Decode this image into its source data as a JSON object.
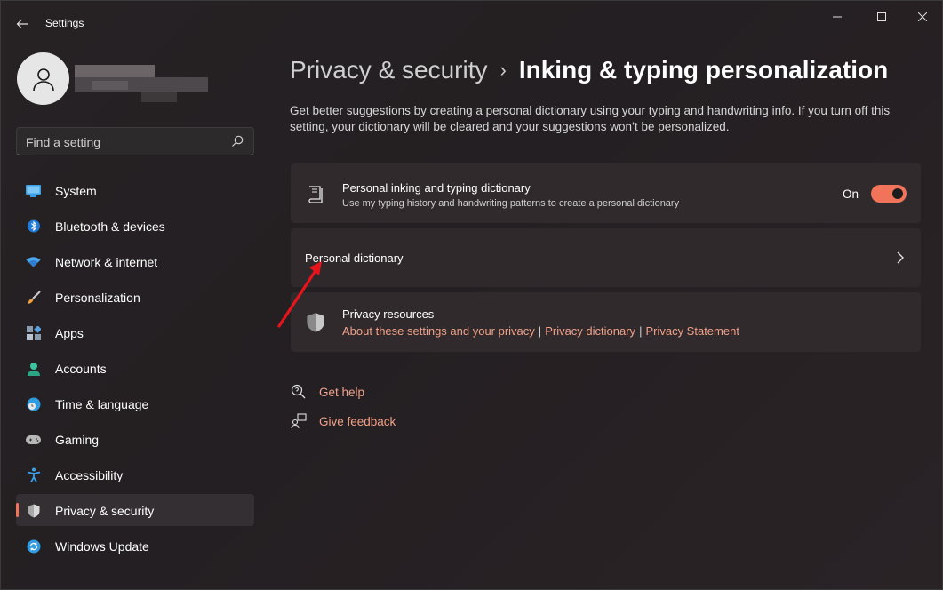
{
  "window": {
    "title": "Settings"
  },
  "search": {
    "placeholder": "Find a setting"
  },
  "sidebar": {
    "items": [
      {
        "label": "System",
        "icon": "monitor-icon",
        "active": false
      },
      {
        "label": "Bluetooth & devices",
        "icon": "bluetooth-icon",
        "active": false
      },
      {
        "label": "Network & internet",
        "icon": "wifi-icon",
        "active": false
      },
      {
        "label": "Personalization",
        "icon": "brush-icon",
        "active": false
      },
      {
        "label": "Apps",
        "icon": "apps-icon",
        "active": false
      },
      {
        "label": "Accounts",
        "icon": "person-icon",
        "active": false
      },
      {
        "label": "Time & language",
        "icon": "globe-clock-icon",
        "active": false
      },
      {
        "label": "Gaming",
        "icon": "gamepad-icon",
        "active": false
      },
      {
        "label": "Accessibility",
        "icon": "accessibility-icon",
        "active": false
      },
      {
        "label": "Privacy & security",
        "icon": "shield-icon",
        "active": true
      },
      {
        "label": "Windows Update",
        "icon": "update-icon",
        "active": false
      }
    ]
  },
  "breadcrumb": {
    "parent": "Privacy & security",
    "separator": "›",
    "current": "Inking & typing personalization"
  },
  "main": {
    "description": "Get better suggestions by creating a personal dictionary using your typing and handwriting info. If you turn off this setting, your dictionary will be cleared and your suggestions won’t be personalized.",
    "dictionary_setting": {
      "title": "Personal inking and typing dictionary",
      "subtitle": "Use my typing history and handwriting patterns to create a personal dictionary",
      "toggle_label": "On",
      "toggle_on": true
    },
    "personal_dictionary": {
      "title": "Personal dictionary"
    },
    "privacy_resources": {
      "title": "Privacy resources",
      "links": [
        "About these settings and your privacy",
        "Privacy dictionary",
        "Privacy Statement"
      ],
      "separator": "|"
    },
    "help": {
      "get_help": "Get help",
      "give_feedback": "Give feedback"
    }
  },
  "colors": {
    "accent": "#f0735a",
    "link": "#f0a189",
    "annotation_arrow": "#e8141c"
  }
}
